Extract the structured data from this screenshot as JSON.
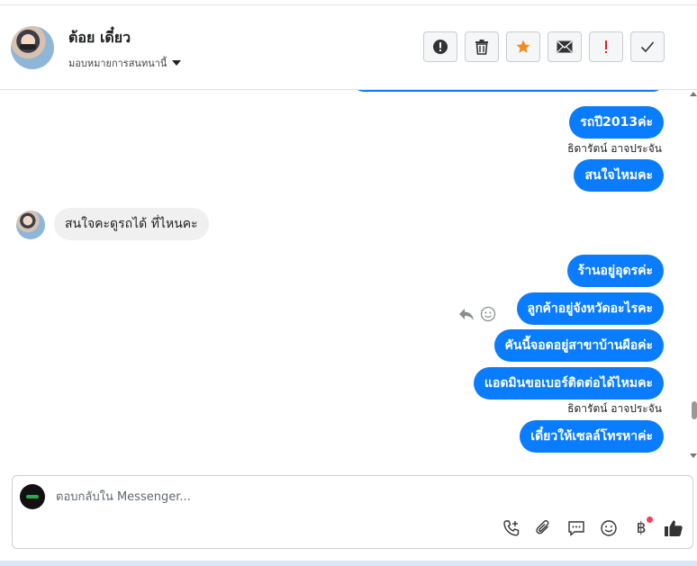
{
  "header": {
    "contact_name": "ต้อย เดี๋ยว",
    "assign_label": "มอบหมายการสนทนานี้",
    "toolbar": [
      {
        "name": "spam-button",
        "icon": "exclamation-circle-icon",
        "color": "#333333"
      },
      {
        "name": "delete-button",
        "icon": "trash-icon",
        "color": "#333333"
      },
      {
        "name": "star-button",
        "icon": "star-icon",
        "color": "#f28b22"
      },
      {
        "name": "mark-unread-button",
        "icon": "envelope-icon",
        "color": "#333333"
      },
      {
        "name": "follow-up-button",
        "icon": "exclamation-icon",
        "color": "#e02020"
      },
      {
        "name": "mark-done-button",
        "icon": "checkmark-icon",
        "color": "#333333"
      }
    ]
  },
  "messages": [
    {
      "direction": "out",
      "text": "รถปี2013ค่ะ"
    },
    {
      "sender": "ธิดารัตน์ อาจประจัน"
    },
    {
      "direction": "out",
      "text": "สนใจไหมคะ"
    },
    {
      "direction": "in",
      "text": "สนใจคะดูรถได้ ที่ไหนคะ"
    },
    {
      "direction": "out",
      "text": "ร้านอยู่อุดรค่ะ"
    },
    {
      "direction": "out",
      "text": "ลูกค้าอยู่จังหวัดอะไรคะ"
    },
    {
      "direction": "out",
      "text": "คันนี้จอดอยู่สาขาบ้านผือค่ะ"
    },
    {
      "direction": "out",
      "text": "แอดมินขอเบอร์ติดต่อได้ไหมคะ"
    },
    {
      "sender": "ธิดารัตน์ อาจประจัน"
    },
    {
      "direction": "out",
      "text": "เดี๋ยวให้เซลล์โทรหาค่ะ"
    }
  ],
  "composer": {
    "placeholder": "ตอบกลับใน Messenger...",
    "tools": [
      "phone-add-icon",
      "paperclip-icon",
      "saved-replies-icon",
      "emoji-icon",
      "baht-icon",
      "thumbs-up-icon"
    ],
    "baht_symbol": "฿"
  },
  "colors": {
    "outgoing_bubble": "#0a7cff",
    "incoming_bubble": "#f0f0f0",
    "star": "#f28b22",
    "alert": "#e02020",
    "notification_dot": "#fa3e5b"
  }
}
